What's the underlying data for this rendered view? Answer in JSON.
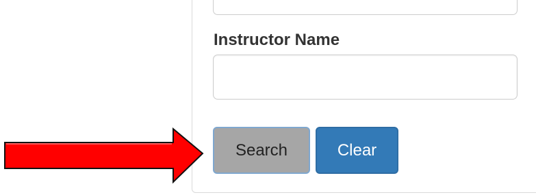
{
  "form": {
    "previous_field_value": "",
    "instructor_label": "Instructor Name",
    "instructor_value": "",
    "instructor_placeholder": ""
  },
  "buttons": {
    "search_label": "Search",
    "clear_label": "Clear"
  },
  "annotation": {
    "arrow_icon": "right-arrow-icon",
    "arrow_color": "#ff0000",
    "arrow_outline_color": "#111111"
  },
  "colors": {
    "search_button_bg": "#a6a6a6",
    "clear_button_bg": "#337ab7"
  }
}
